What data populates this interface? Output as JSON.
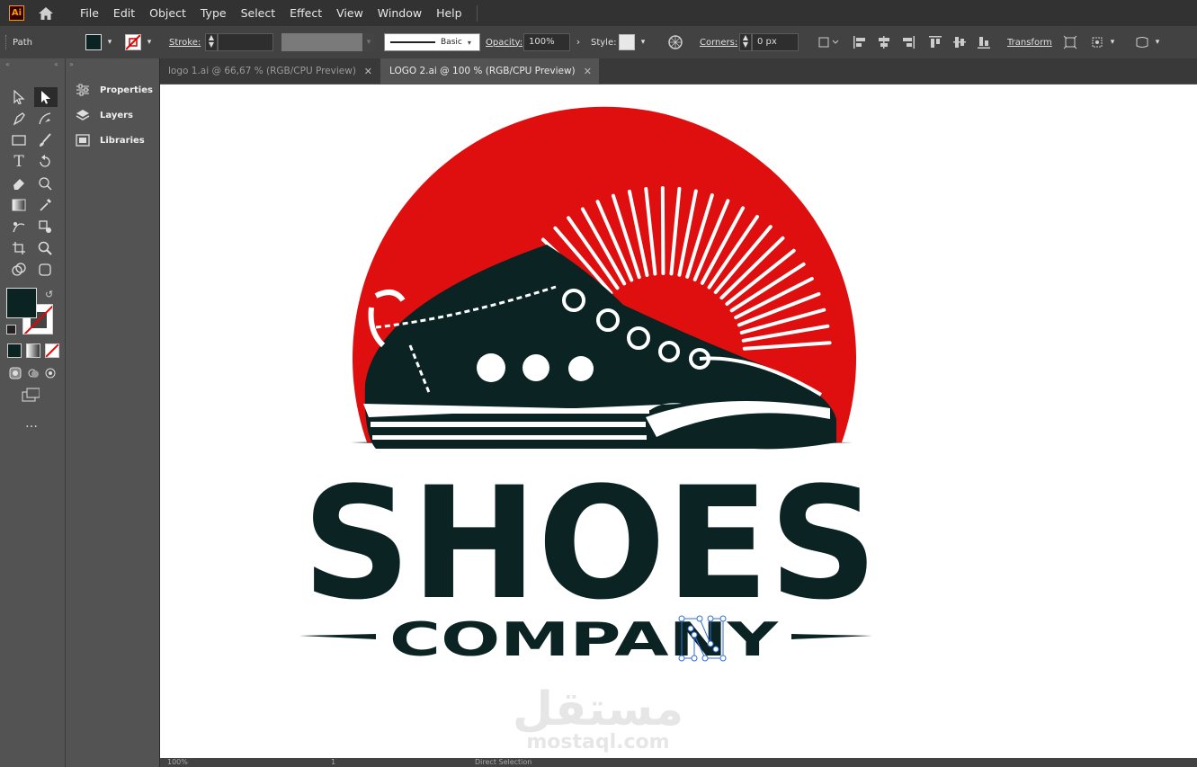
{
  "app": {
    "logo": "Ai"
  },
  "menu": [
    "File",
    "Edit",
    "Object",
    "Type",
    "Select",
    "Effect",
    "View",
    "Window",
    "Help"
  ],
  "control": {
    "selection": "Path",
    "stroke_label": "Stroke:",
    "brush": "Basic",
    "opacity_label": "Opacity:",
    "opacity_value": "100%",
    "style_label": "Style:",
    "corners_label": "Corners:",
    "corners_value": "0 px",
    "transform_label": "Transform"
  },
  "tabs": [
    {
      "label": "logo 1.ai @ 66,67 % (RGB/CPU Preview)",
      "active": false
    },
    {
      "label": "LOGO 2.ai @ 100 % (RGB/CPU Preview)",
      "active": true
    }
  ],
  "panels": [
    "Properties",
    "Layers",
    "Libraries"
  ],
  "artwork": {
    "headline": "SHOES",
    "tagline": "COMPANY",
    "watermark_text": "mostaql.com",
    "watermark_logo": "مستقل"
  },
  "status": {
    "zoom": "100%",
    "page": "1",
    "tool": "Direct Selection"
  },
  "colors": {
    "red": "#e00f0f",
    "dark": "#0b2323",
    "ui_bg": "#535353"
  }
}
